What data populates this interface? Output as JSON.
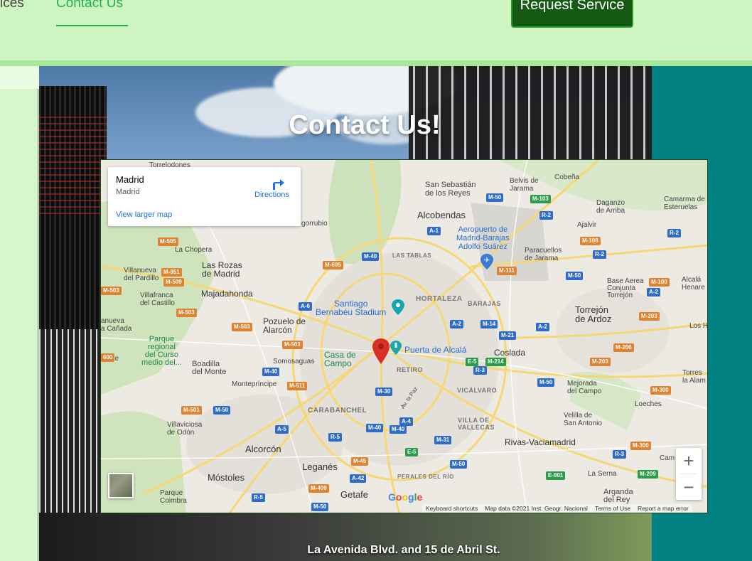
{
  "nav": {
    "services_label": "ices",
    "contact_label": "Contact Us",
    "request_button": "Request Service"
  },
  "hero": {
    "title": "Contact Us!",
    "address": "La Avenida Blvd. and 15 de Abril St."
  },
  "map": {
    "place_title": "Madrid",
    "place_subtitle": "Madrid",
    "directions_label": "Directions",
    "view_larger_label": "View larger map",
    "zoom_in": "+",
    "zoom_out": "−",
    "google_label": "Google",
    "attribution": [
      "Keyboard shortcuts",
      "Map data ©2021 Inst. Geogr. Nacional",
      "Terms of Use",
      "Report a map error"
    ],
    "labels": {
      "torrelodones": "Torrelodones",
      "san_sebastian": "San Sebastián\nde los Reyes",
      "belvis": "Belvis de\nJarama",
      "cobena": "Cobeña",
      "daganzo": "Daganzo\nde Arriba",
      "camarma": "Camarma de\nEsteruelas",
      "alcobendas": "Alcobendas",
      "ajalvir": "Ajalvir",
      "aeropuerto": "Aeropuerto de\nMadrid-Barajas\nAdolfo Suárez",
      "paracuellos": "Paracuellos\nde Jarama",
      "gorrubio": "gorrubio",
      "la_chopera": "La Chopera",
      "las_rozas": "Las Rozas\nde Madrid",
      "las_tablas": "LAS TABLAS",
      "villanueva_pardillo": "Villanueva\ndel Pardillo",
      "majadahonda": "Majadahonda",
      "villafranca": "Villafranca\ndel Castillo",
      "hortaleza": "HORTALEZA",
      "barajas": "BARAJAS",
      "santiago": "Santiago\nBernabéu Stadium",
      "base_aerea": "Base Aerea\nConjunta\nTorrejón",
      "alcala": "Alcalá\nHenare",
      "torrejon": "Torrejón\nde Ardoz",
      "los_h": "Los H",
      "villanueva_canada": "anueva\na Cañada",
      "pozuelo": "Pozuelo de\nAlarcón",
      "parque_regional": "Parque\nregional\ndel Curso\nmedio del...",
      "puerta_alcala": "Puerta de Alcalá",
      "coslada": "Coslada",
      "casa_campo": "Casa de\nCampo",
      "somosaguas": "Somosaguas",
      "boadilla": "Boadilla\ndel Monte",
      "retiro": "RETIRO",
      "unete": "unete",
      "montepríncipe": "Montepríncipe",
      "vicalvaro": "VICÁLVARO",
      "mejorada": "Mejorada\ndel Campo",
      "torres": "Torres\nla Alam",
      "carabanchel": "CARABANCHEL",
      "loeches": "Loeches",
      "villa_vallecas": "VILLA DE\nVALLECAS",
      "villaviciosa": "Villaviciosa\nde Odón",
      "velilla": "Velilla de\nSan Antonio",
      "rivas": "Rivas-Vaciamadrid",
      "alcorcon": "Alcorcón",
      "leganes": "Leganés",
      "mostoles": "Móstoles",
      "perales": "PERALES DEL RÍO",
      "la_serna": "La Serna",
      "cam": "Cam",
      "arganda": "Arganda\ndel Rey",
      "parque_coimbra": "Parque\nCoimbra",
      "getafe": "Getafe",
      "av_paz": "Av. la Paz"
    }
  }
}
